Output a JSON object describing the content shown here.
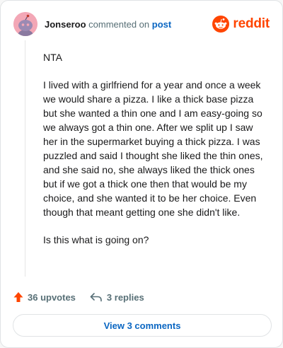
{
  "header": {
    "username": "Jonseroo",
    "action_text": "commented on",
    "post_link": "post",
    "brand_name": "reddit",
    "brand_icon": "reddit-logo-icon",
    "avatar_icon": "snoo-avatar-icon"
  },
  "comment": {
    "paragraphs": [
      "NTA",
      "I lived with a girlfriend for a year and once a week we would share a pizza. I like a thick base pizza but she wanted a thin one and I am easy-going so we always got a thin one. After we split up I saw her in the supermarket buying a thick pizza. I was puzzled and said I thought she liked the thin ones, and she said no, she always liked the thick ones but if we got a thick one then that would be my choice, and she wanted it to be her choice. Even though that meant getting one she didn't like.",
      "Is this what is going on?"
    ]
  },
  "actions": {
    "upvotes": "36 upvotes",
    "replies": "3 replies",
    "upvote_icon": "upvote-arrow-icon",
    "reply_icon": "reply-arrow-icon"
  },
  "footer": {
    "view_button": "View 3 comments"
  },
  "colors": {
    "brand": "#ff4500",
    "link": "#0a66c2",
    "muted": "#576f76",
    "avatar_bg": "#f3a7b6"
  }
}
